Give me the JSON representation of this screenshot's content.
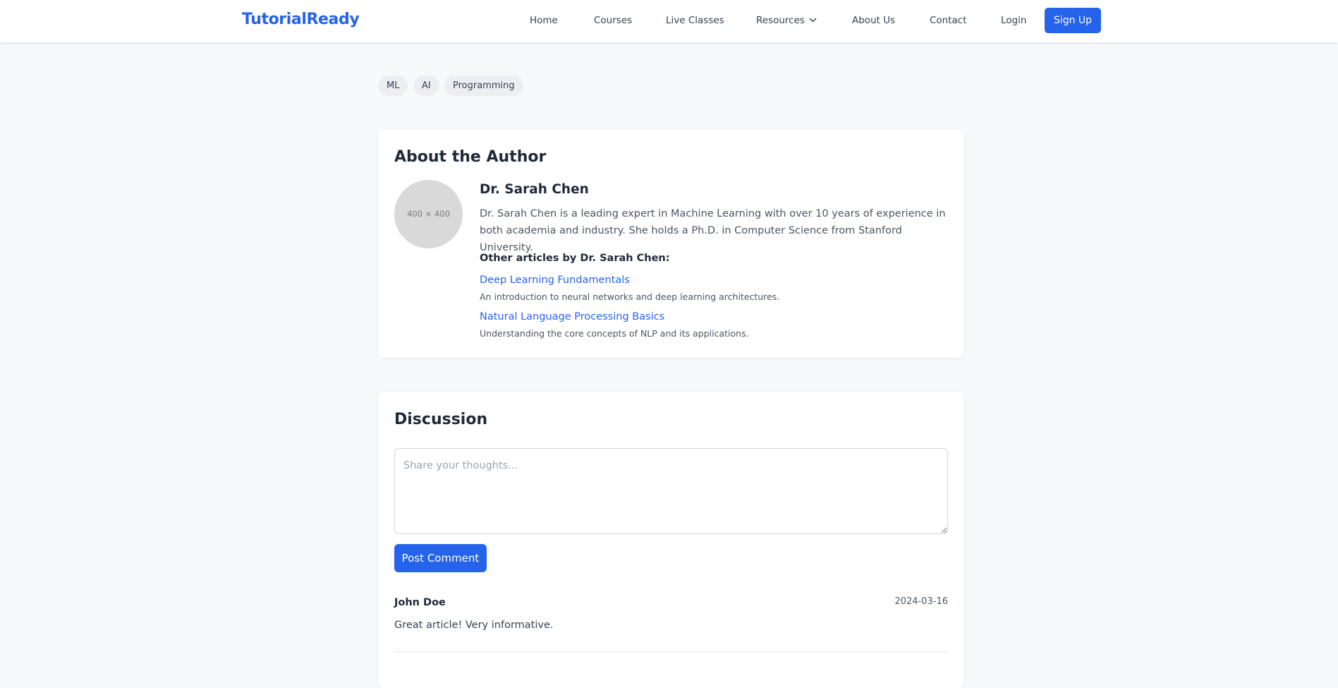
{
  "nav": {
    "brand": "TutorialReady",
    "links": [
      "Home",
      "Courses",
      "Live Classes",
      "Resources",
      "About Us",
      "Contact"
    ],
    "login": "Login",
    "signup": "Sign Up"
  },
  "tags": [
    "ML",
    "AI",
    "Programming"
  ],
  "author": {
    "section_title": "About the Author",
    "avatar_placeholder": "400 × 400",
    "name": "Dr. Sarah Chen",
    "bio": "Dr. Sarah Chen is a leading expert in Machine Learning with over 10 years of experience in both academia and industry. She holds a Ph.D. in Computer Science from Stanford University.",
    "other_heading": "Other articles by Dr. Sarah Chen:",
    "articles": [
      {
        "title": "Deep Learning Fundamentals",
        "desc": "An introduction to neural networks and deep learning architectures."
      },
      {
        "title": "Natural Language Processing Basics",
        "desc": "Understanding the core concepts of NLP and its applications."
      }
    ]
  },
  "discussion": {
    "title": "Discussion",
    "placeholder": "Share your thoughts...",
    "post_button": "Post Comment",
    "comments": [
      {
        "author": "John Doe",
        "date": "2024-03-16",
        "text": "Great article! Very informative."
      }
    ]
  },
  "colors": {
    "accent": "#2563eb",
    "background": "#f8f9fb",
    "card": "#ffffff",
    "tag_bg": "#eceef2"
  },
  "icons": {
    "resources_dropdown": "chevron-down-icon"
  }
}
